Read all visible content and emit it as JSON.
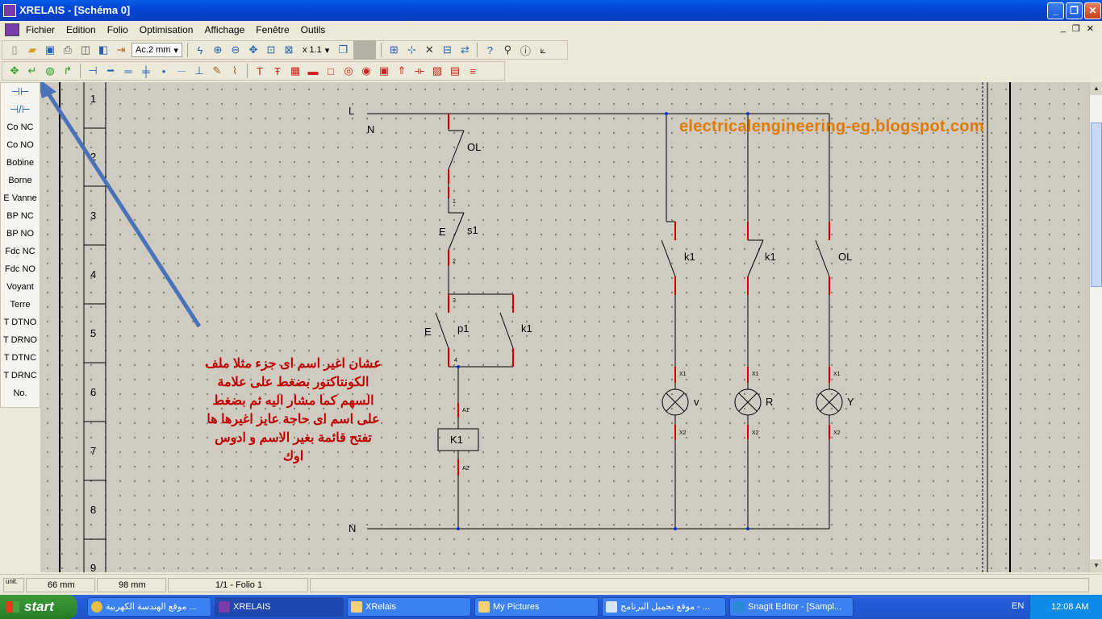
{
  "window": {
    "title": "XRELAIS - [Schéma 0]"
  },
  "menu": [
    "Fichier",
    "Edition",
    "Folio",
    "Optimisation",
    "Affichage",
    "Fenêtre",
    "Outils"
  ],
  "toolbar": {
    "line_style": "Ac.2 mm",
    "zoom": "x 1.1"
  },
  "palette": [
    "Co NC",
    "Co NO",
    "Bobine",
    "Borne",
    "E Vanne",
    "BP NC",
    "BP NO",
    "Fdc NC",
    "Fdc NO",
    "Voyant",
    "Terre",
    "T DTNO",
    "T DRNO",
    "T DTNC",
    "T DRNC",
    "No."
  ],
  "row_numbers": [
    "1",
    "2",
    "3",
    "4",
    "5",
    "6",
    "7",
    "8",
    "9"
  ],
  "schematic": {
    "rail_L": "L",
    "rail_N_top": "N",
    "rail_N_bottom": "N",
    "OL_control": "OL",
    "s1": "s1",
    "E1": "E",
    "p1": "p1",
    "E2": "E",
    "k1_hold": "k1",
    "coil": "K1",
    "A1": "A1",
    "A2": "A2",
    "k1_a": "k1",
    "k1_b": "k1",
    "OL_power": "OL",
    "lamp_v": "v",
    "lamp_R": "R",
    "lamp_Y": "Y",
    "X1": "X1",
    "X2": "X2",
    "n1": "1",
    "n2": "2",
    "n3": "3",
    "n4": "4"
  },
  "watermark": "electricalengineering-eg.blogspot.com",
  "note": "عشان اغير اسم اى جزء مثلا ملف\nالكونتاكتور بضغط على علامة\nالسهم كما مشار اليه ثم بضغط\nعلى اسم اى حاجة عايز اغيرها ها\nتفتح قائمة بغير الاسم و ادوس\nاوك",
  "status": {
    "x": "66 mm",
    "y": "98 mm",
    "folio": "1/1 - Folio 1",
    "unit": "unit."
  },
  "taskbar": {
    "start": "start",
    "tasks": [
      "موقع الهندسة الكهربية ...",
      "XRELAIS",
      "XRelais",
      "My Pictures",
      "موقع تحميل البرنامج - ...",
      "Snagit Editor - [Sampl..."
    ],
    "lang": "EN",
    "clock": "12:08 AM"
  }
}
